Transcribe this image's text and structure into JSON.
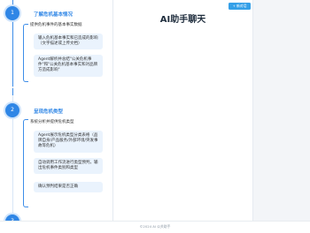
{
  "timeline": {
    "steps": [
      {
        "number": "1",
        "title": "了解危机基本情况",
        "description": "提供危机事件的基本事实数据",
        "cards": [
          "输入危机基本事实和已造成的影响（文字描述或上传文档）",
          "Agent解析并总结\"公关危机事件\"和\"公关危机基本事实和对品牌方造成影响\""
        ]
      },
      {
        "number": "2",
        "title": "呈现危机类型",
        "description": "系统分析并提供危机类型",
        "cards": [
          "Agent展示危机类型分类表格（品牌自身/产品服务/外部环境/突发事故等危机）",
          "自动调用工作流进行类型预判，输出危机事件类别和类型",
          "确认预判结果是否正确"
        ]
      },
      {
        "number": "3"
      }
    ]
  },
  "main": {
    "title": "AI助手聊天",
    "new_chat_label": "+ 新对话"
  },
  "footer": {
    "text": "©2024 AI 公关助手"
  },
  "colors": {
    "accent": "#2f86e6",
    "card_bg": "#eaf3fd",
    "button": "#35a0e8"
  }
}
